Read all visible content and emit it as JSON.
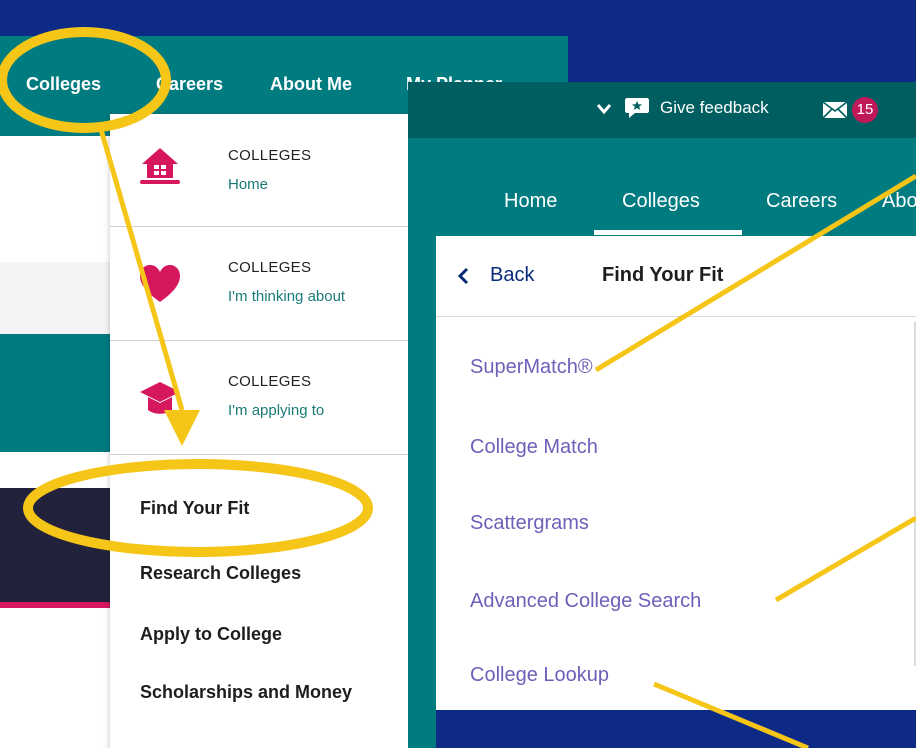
{
  "left": {
    "topnav": [
      "Colleges",
      "Careers",
      "About Me",
      "My Planner"
    ],
    "dropdown_cards": [
      {
        "label": "COLLEGES",
        "sub": "Home",
        "icon": "home-icon"
      },
      {
        "label": "COLLEGES",
        "sub": "I'm thinking about",
        "icon": "heart-icon"
      },
      {
        "label": "COLLEGES",
        "sub": "I'm applying to",
        "icon": "graduation-cap-icon"
      }
    ],
    "dropdown_links": [
      "Find Your Fit",
      "Research Colleges",
      "Apply to College",
      "Scholarships and Money"
    ]
  },
  "right": {
    "header": {
      "feedback": "Give feedback",
      "message_count": "15"
    },
    "nav": [
      "Home",
      "Colleges",
      "Careers",
      "About Me"
    ],
    "menu": {
      "back": "Back",
      "title": "Find Your Fit",
      "items": [
        "SuperMatch®",
        "College Match",
        "Scattergrams",
        "Advanced College Search",
        "College Lookup"
      ]
    }
  },
  "colors": {
    "background": "#0d2a86",
    "teal": "#007b7f",
    "dark_teal": "#005e60",
    "highlight": "#f5c518",
    "link": "#6e5fb8",
    "pink": "#d6175e",
    "badge": "#c0195a"
  }
}
